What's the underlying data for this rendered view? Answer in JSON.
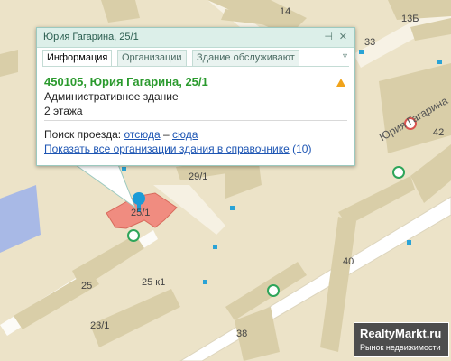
{
  "popup": {
    "title": "Юрия Гагарина, 25/1",
    "pin_icon": "pin-icon",
    "close_icon": "close-icon",
    "tabs": [
      "Информация",
      "Организации",
      "Здание обслуживают"
    ],
    "menu_icon": "menu-icon",
    "address": "450105, Юрия Гагарина, 25/1",
    "type": "Административное здание",
    "floors": "2 этажа",
    "route_label": "Поиск проезда:",
    "route_from": "отсюда",
    "route_dash": "–",
    "route_to": "сюда",
    "orgs_link": "Показать все организации здания в справочнике",
    "orgs_count": "(10)"
  },
  "map": {
    "street_name": "Юрия Гагарина",
    "labels": [
      "14",
      "13Б",
      "33",
      "42",
      "29/1",
      "25/1",
      "40",
      "25",
      "25 к1",
      "23/1",
      "38"
    ],
    "colors": {
      "road": "#ffffff",
      "block": "#ece3c8",
      "building": "#d9cea8",
      "selected": "#f08c80",
      "marker": "#2aa3d6"
    }
  },
  "logo": {
    "name": "RealtyMarkt.ru",
    "tagline": "Рынок недвижимости"
  }
}
